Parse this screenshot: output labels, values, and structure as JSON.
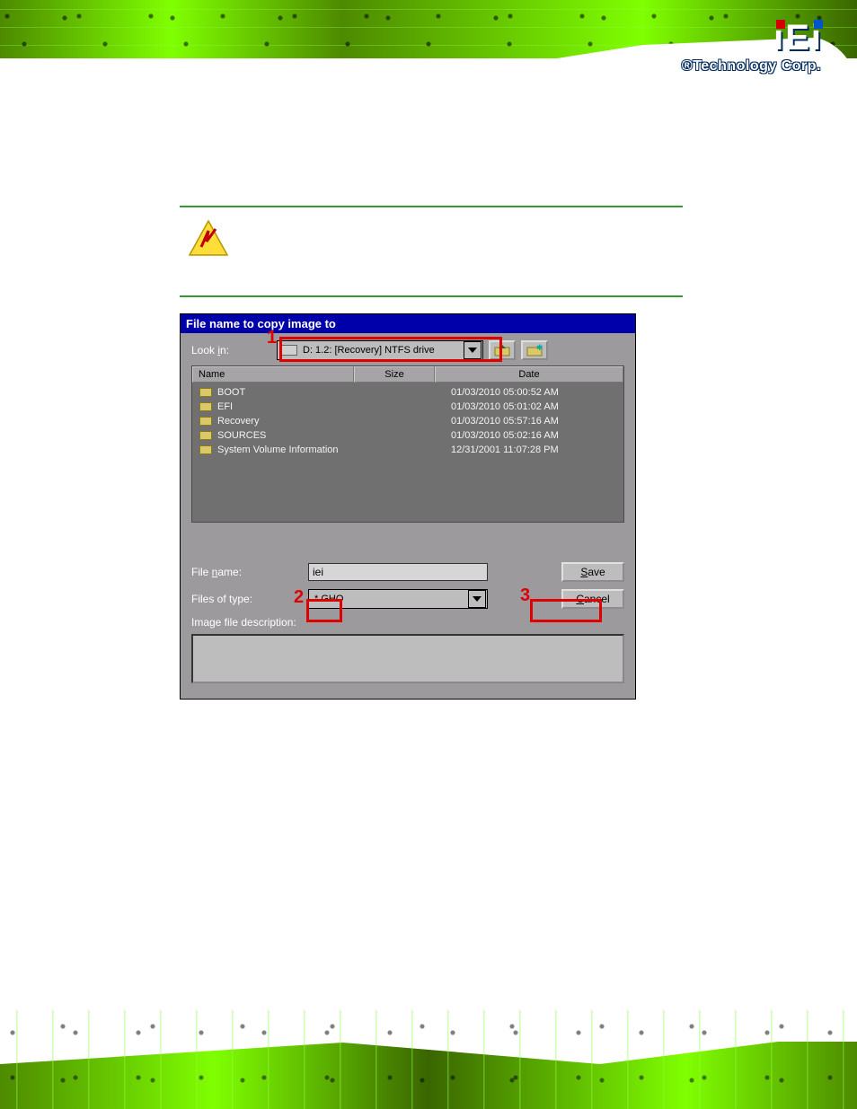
{
  "brand": {
    "logo_text": "iEi",
    "tagline_prefix": "®",
    "tagline": "Technology Corp."
  },
  "dialog": {
    "title": "File name to copy image to",
    "look_in_label": "Look in:",
    "look_in_value": "D: 1.2: [Recovery] NTFS drive",
    "columns": {
      "name": "Name",
      "size": "Size",
      "date": "Date"
    },
    "rows": [
      {
        "name": "BOOT",
        "size": "",
        "date": "01/03/2010 05:00:52 AM"
      },
      {
        "name": "EFI",
        "size": "",
        "date": "01/03/2010 05:01:02 AM"
      },
      {
        "name": "Recovery",
        "size": "",
        "date": "01/03/2010 05:57:16 AM"
      },
      {
        "name": "SOURCES",
        "size": "",
        "date": "01/03/2010 05:02:16 AM"
      },
      {
        "name": "System Volume Information",
        "size": "",
        "date": "12/31/2001 11:07:28 PM"
      }
    ],
    "file_name_label": "File name:",
    "file_name_value": "iei",
    "files_of_type_label": "Files of type:",
    "files_of_type_value": "*.GHO",
    "image_desc_label": "Image file description:",
    "save_label": "Save",
    "cancel_label": "Cancel",
    "annotations": {
      "n1": "1",
      "n2": "2",
      "n3": "3"
    }
  }
}
